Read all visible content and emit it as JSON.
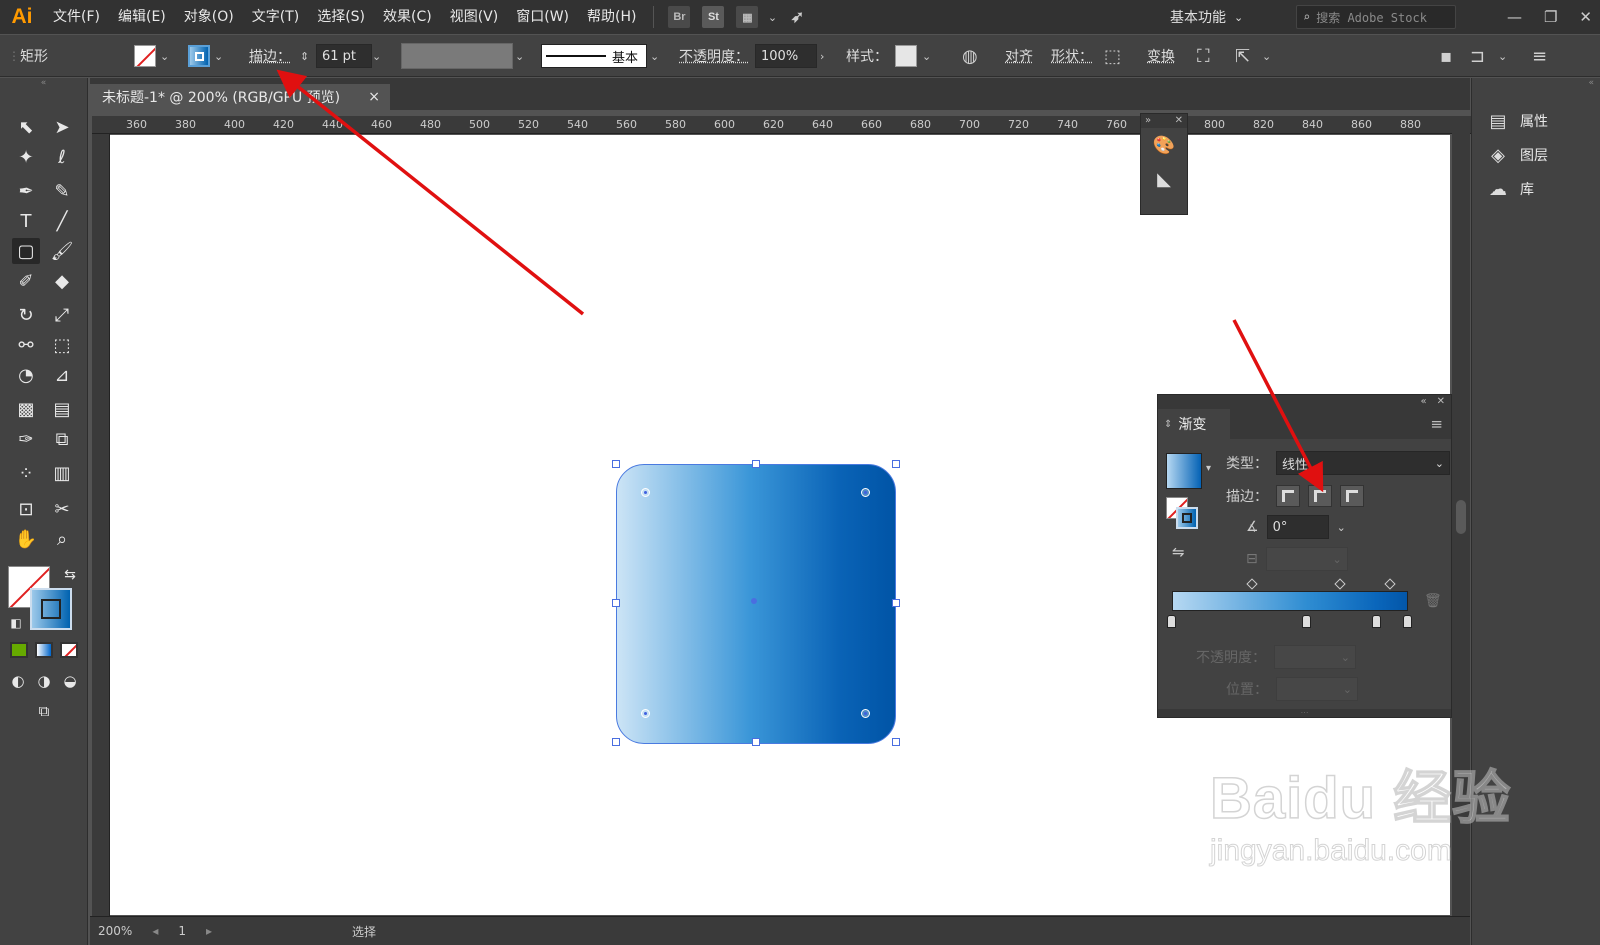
{
  "app": {
    "logo": "Ai",
    "workspace": "基本功能",
    "search_placeholder": "搜索 Adobe Stock"
  },
  "menu": [
    "文件(F)",
    "编辑(E)",
    "对象(O)",
    "文字(T)",
    "选择(S)",
    "效果(C)",
    "视图(V)",
    "窗口(W)",
    "帮助(H)"
  ],
  "app_buttons": {
    "bridge": "Br",
    "stock": "St"
  },
  "control": {
    "object_type": "矩形",
    "stroke_label": "描边：",
    "stroke_weight": "61 pt",
    "stroke_profile": "基本",
    "opacity_label": "不透明度：",
    "opacity_value": "100%",
    "style_label": "样式：",
    "align_label": "对齐",
    "shape_label": "形状：",
    "transform_label": "变换"
  },
  "document": {
    "tab_title": "未标题-1* @ 200% (RGB/GPU 预览)",
    "close": "×"
  },
  "ruler": {
    "h_ticks": [
      "360",
      "380",
      "400",
      "420",
      "440",
      "460",
      "480",
      "500",
      "520",
      "540",
      "560",
      "580",
      "600",
      "620",
      "640",
      "660",
      "680",
      "700",
      "720",
      "740",
      "760",
      "780",
      "800",
      "820",
      "840",
      "860",
      "880"
    ]
  },
  "right_dock": {
    "items": [
      {
        "label": "属性",
        "icon": "properties-icon"
      },
      {
        "label": "图层",
        "icon": "layers-icon"
      },
      {
        "label": "库",
        "icon": "libraries-icon"
      }
    ]
  },
  "gradient_panel": {
    "title": "渐变",
    "type_label": "类型：",
    "type_value": "线性",
    "stroke_label": "描边：",
    "angle_value": "0°",
    "opacity_label": "不透明度：",
    "position_label": "位置：",
    "stops": [
      0,
      57,
      87,
      100
    ],
    "colors": [
      "#b6d8f2",
      "#2f8dd2",
      "#0a66bb",
      "#0356a8"
    ]
  },
  "statusbar": {
    "zoom": "200%",
    "page": "1",
    "tool": "选择"
  },
  "watermark": {
    "logo": "Baidu 经验",
    "url": "jingyan.baidu.com"
  },
  "colors": {
    "accent": "#ff9a00",
    "shape_start": "#cce4f6",
    "shape_end": "#0054a6",
    "arrow": "#e01010"
  }
}
